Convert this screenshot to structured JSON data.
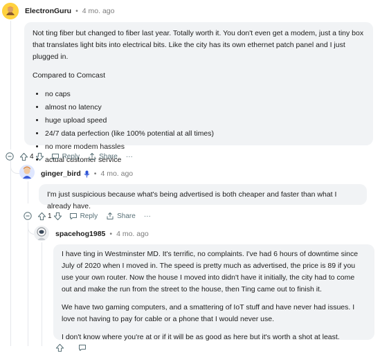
{
  "comments": [
    {
      "username": "ElectronGuru",
      "time": "4 mo. ago",
      "para1": "Not ting fiber but changed to fiber last year. Totally worth it. You don't even get a modem, just a tiny box that translates light bits into electrical bits. Like the city has its own ethernet patch panel and I just plugged in.",
      "para2": "Compared to Comcast",
      "list": [
        "no caps",
        "almost no latency",
        "huge upload speed",
        "24/7 data perfection (like 100% potential at all times)",
        "no more modem hassles",
        "actual customer service"
      ],
      "votes": "4",
      "reply_label": "Reply",
      "share_label": "Share",
      "more_label": "···"
    },
    {
      "username": "ginger_bird",
      "time": "4 mo. ago",
      "para1": "I'm just suspicious because what's being advertised is both cheaper and faster than what I already have.",
      "votes": "1",
      "reply_label": "Reply",
      "share_label": "Share",
      "more_label": "···"
    },
    {
      "username": "spacehog1985",
      "time": "4 mo. ago",
      "para1": "I have ting in Westminster MD. It's terrific, no complaints. I've had 6 hours of downtime since July of 2020 when I moved in. The speed is pretty much as advertised, the price is 89 if you use your own router. Now the house I moved into didn't have it initially, the city had to come out and make the run from the street to the house, then Ting came out to finish it.",
      "para2": "We have two gaming computers, and a smattering of IoT stuff and have never had issues. I love not having to pay for cable or a phone that I would never use.",
      "para3": "I don't know where you're at or if it will be as good as here but it's worth a shot at least."
    }
  ]
}
